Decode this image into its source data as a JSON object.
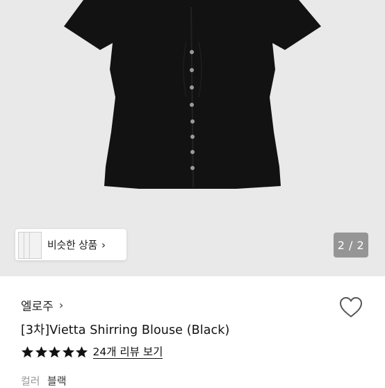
{
  "product": {
    "brand": "엘로주",
    "title": "[3차]Vietta Shirring Blouse (Black)",
    "review_link": "24개 리뷰 보기",
    "rating_stars": 5,
    "color_label": "컬러",
    "color_value": "블랙"
  },
  "gallery": {
    "counter": "2 / 2",
    "similar_label": "비슷한 상품"
  },
  "icons": {
    "brand_chevron": "chevron-right-icon",
    "similar_chevron": "chevron-right-icon",
    "wishlist": "heart-outline-icon",
    "star": "star-filled-icon"
  },
  "colors": {
    "photo_bg": "#e9e9e9",
    "garment": "#111111",
    "counter_bg": "#787878"
  }
}
